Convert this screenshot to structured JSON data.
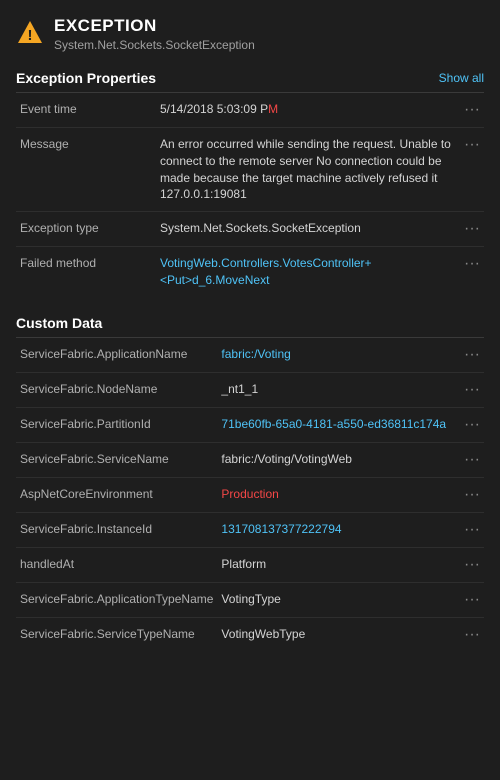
{
  "header": {
    "icon": "warning",
    "title": "EXCEPTION",
    "subtitle": "System.Net.Sockets.SocketException"
  },
  "exception_properties": {
    "section_title": "Exception Properties",
    "show_all_label": "Show all",
    "rows": [
      {
        "key": "Event time",
        "value_parts": [
          {
            "text": "5/14/2018 5:03:09 P",
            "highlight": false
          },
          {
            "text": "M",
            "highlight": true
          }
        ],
        "value_plain": "5/14/2018 5:03:09 PM"
      },
      {
        "key": "Message",
        "value_parts": [
          {
            "text": "An error occurred while sending the request. Unable to connect to the remote server No connection could be made because the target machine actively refused it 127.0.0.1:19081",
            "highlight": false
          }
        ],
        "value_plain": "An error occurred while sending the request. Unable to connect to the remote server No connection could be made because the target machine actively refused it 127.0.0.1:19081"
      },
      {
        "key": "Exception type",
        "value_parts": [
          {
            "text": "System.Net.Sockets.SocketException",
            "highlight": false
          }
        ],
        "value_plain": "System.Net.Sockets.SocketException"
      },
      {
        "key": "Failed method",
        "value_parts": [
          {
            "text": "VotingWeb.Controllers.VotesController+<Put>d_6.MoveNext",
            "highlight": false,
            "link": true
          }
        ],
        "value_plain": "VotingWeb.Controllers.VotesController+<Put>d_6.MoveNext"
      }
    ]
  },
  "custom_data": {
    "section_title": "Custom Data",
    "rows": [
      {
        "key": "ServiceFabric.ApplicationName",
        "value_parts": [
          {
            "text": "fabric:/Voting",
            "highlight": false,
            "link": true
          }
        ],
        "value_plain": "fabric:/Voting"
      },
      {
        "key": "ServiceFabric.NodeName",
        "value_parts": [
          {
            "text": "_nt1_1",
            "highlight": false
          }
        ],
        "value_plain": "_nt1_1"
      },
      {
        "key": "ServiceFabric.PartitionId",
        "value_parts": [
          {
            "text": "71be60fb-65a0-4181-a550-ed36811c174a",
            "highlight": false,
            "link": true
          }
        ],
        "value_plain": "71be60fb-65a0-4181-a550-ed36811c174a"
      },
      {
        "key": "ServiceFabric.ServiceName",
        "value_parts": [
          {
            "text": "fabric:/Voting/VotingWeb",
            "highlight": false
          }
        ],
        "value_plain": "fabric:/Voting/VotingWeb"
      },
      {
        "key": "AspNetCoreEnvironment",
        "value_parts": [
          {
            "text": "Production",
            "highlight": true
          }
        ],
        "value_plain": "Production"
      },
      {
        "key": "ServiceFabric.InstanceId",
        "value_parts": [
          {
            "text": "131708137377222794",
            "highlight": false,
            "link": true
          }
        ],
        "value_plain": "131708137377222794"
      },
      {
        "key": "handledAt",
        "value_parts": [
          {
            "text": "Platform",
            "highlight": false
          }
        ],
        "value_plain": "Platform"
      },
      {
        "key": "ServiceFabric.ApplicationTypeName",
        "value_parts": [
          {
            "text": "VotingType",
            "highlight": false
          }
        ],
        "value_plain": "VotingType"
      },
      {
        "key": "ServiceFabric.ServiceTypeName",
        "value_parts": [
          {
            "text": "VotingWebType",
            "highlight": false
          }
        ],
        "value_plain": "VotingWebType"
      }
    ]
  },
  "icons": {
    "menu_dots": "···",
    "warning_symbol": "⚠"
  }
}
